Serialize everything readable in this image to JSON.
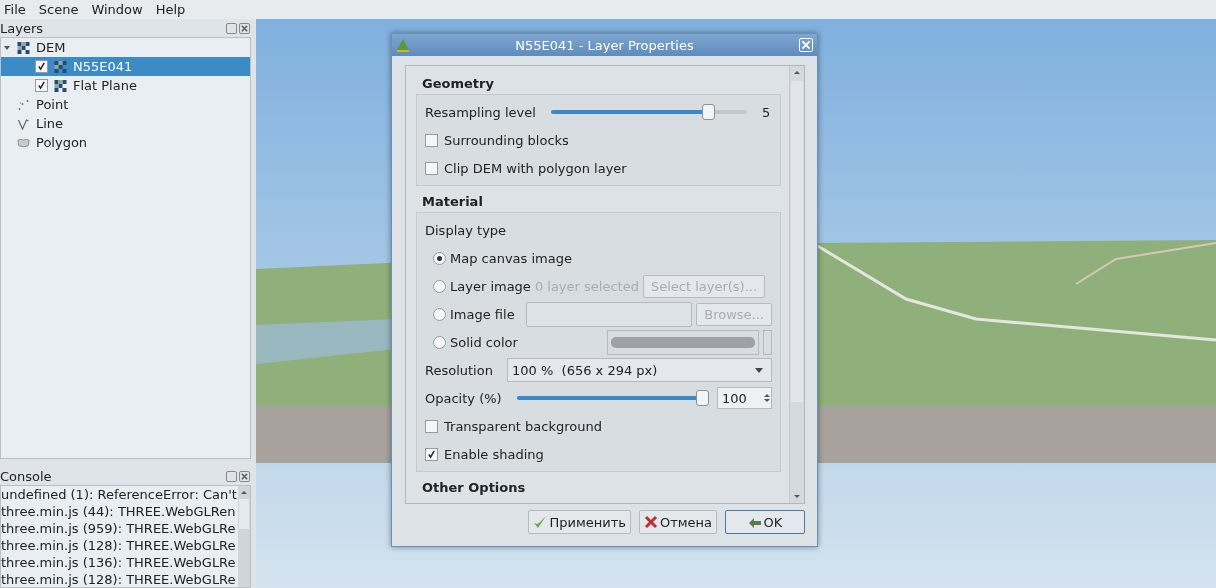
{
  "menu": [
    "File",
    "Scene",
    "Window",
    "Help"
  ],
  "layers_panel": {
    "title": "Layers",
    "items": [
      {
        "label": "DEM",
        "kind": "dem",
        "expanded": true,
        "selected": false,
        "children": [
          {
            "label": "N55E041",
            "kind": "dem",
            "checked": true,
            "selected": true
          },
          {
            "label": "Flat Plane",
            "kind": "dem",
            "checked": true,
            "selected": false
          }
        ]
      },
      {
        "label": "Point",
        "kind": "point",
        "selected": false
      },
      {
        "label": "Line",
        "kind": "line",
        "selected": false
      },
      {
        "label": "Polygon",
        "kind": "polygon",
        "selected": false
      }
    ]
  },
  "console": {
    "title": "Console",
    "lines": [
      "undefined (1): ReferenceError: Can't",
      "three.min.js (44): THREE.WebGLRen",
      "three.min.js (959): THREE.WebGLRe",
      "three.min.js (128): THREE.WebGLRe",
      "three.min.js (136): THREE.WebGLRe",
      "three.min.js (128): THREE.WebGLRe"
    ]
  },
  "dialog": {
    "title": "N55E041 - Layer Properties",
    "geometry": {
      "title": "Geometry",
      "slider": {
        "label": "Resampling level",
        "level": 0.8,
        "value": "5"
      },
      "options": [
        {
          "label": "Surrounding blocks",
          "checked": false
        },
        {
          "label": "Clip DEM with polygon layer",
          "checked": false
        }
      ]
    },
    "material": {
      "title": "Material",
      "display_type_label": "Display type",
      "display_types": [
        {
          "kind": "plain",
          "label": "Map canvas image",
          "selected": true
        },
        {
          "kind": "layer",
          "label": "Layer image",
          "selected": false,
          "note": "0 layer selected",
          "button": "Select layer(s)...",
          "disabled": true
        },
        {
          "kind": "file",
          "label": "Image file",
          "selected": false,
          "button": "Browse...",
          "disabled": true
        },
        {
          "kind": "color",
          "label": "Solid color",
          "selected": false,
          "color": "#9ea2a6"
        }
      ],
      "resolution": {
        "label": "Resolution",
        "value": "100 %  (656 x 294 px)"
      },
      "opacity": {
        "label": "Opacity (%)",
        "level": 1,
        "value": "100"
      },
      "options": [
        {
          "label": "Transparent background",
          "checked": false
        },
        {
          "label": "Enable shading",
          "checked": true
        }
      ]
    },
    "other_options": {
      "title": "Other Options"
    },
    "buttons": [
      {
        "label": "Применить",
        "kind": "apply",
        "default": false
      },
      {
        "label": "Отмена",
        "kind": "cancel",
        "default": false
      },
      {
        "label": "OK",
        "kind": "ok",
        "default": true
      }
    ]
  }
}
